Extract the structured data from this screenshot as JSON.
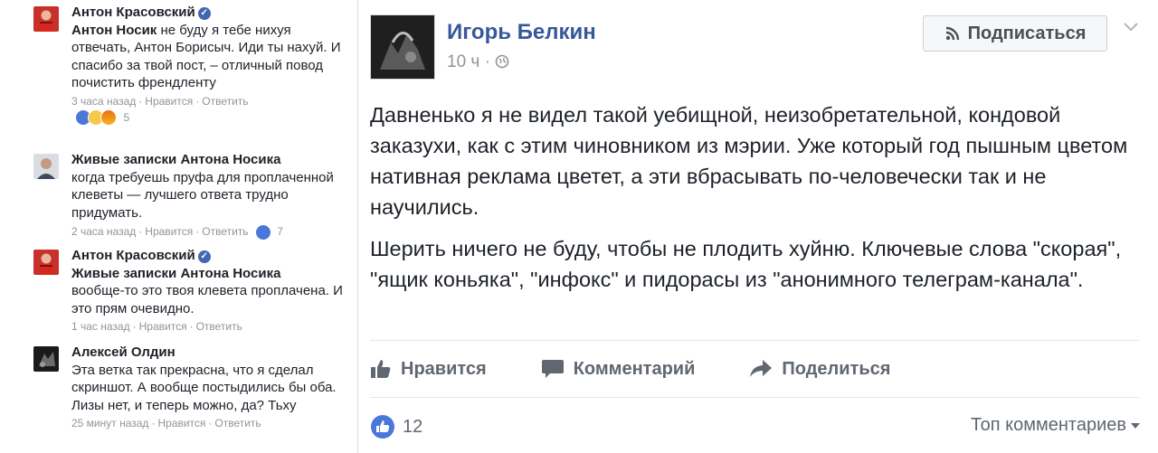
{
  "comments": [
    {
      "author": "Антон Красовский",
      "verified": true,
      "mention": "Антон Носик",
      "text": " не буду я тебе нихуя отвечать, Антон Борисыч. Иди ты нахуй. И спасибо за твой пост, – отличный повод почистить френдленту",
      "time": "3 часа назад",
      "like": "Нравится",
      "reply": "Ответить",
      "reactions_count": "5"
    },
    {
      "author": "Живые записки Антона Носика",
      "verified": false,
      "mention": "",
      "text": "когда требуешь пруфа для проплаченной клеветы — лучшего ответа трудно придумать.",
      "time": "2 часа назад",
      "like": "Нравится",
      "reply": "Ответить",
      "reactions_count": "7"
    },
    {
      "author": "Антон Красовский",
      "verified": true,
      "mention": "Живые записки Антона Носика",
      "text": "вообще-то это твоя клевета проплачена. И это прям очевидно.",
      "time": "1 час назад",
      "like": "Нравится",
      "reply": "Ответить",
      "reactions_count": ""
    },
    {
      "author": "Алексей Олдин",
      "verified": false,
      "mention": "",
      "text": "Эта ветка так прекрасна, что я сделал скриншот. А вообще постыдились бы оба. Лизы нет, и теперь можно, да? Тьху",
      "time": "25 минут назад",
      "like": "Нравится",
      "reply": "Ответить",
      "reactions_count": ""
    }
  ],
  "post": {
    "author": "Игорь Белкин",
    "time": "10 ч",
    "subscribe_label": "Подписаться",
    "paragraph1": "Давненько я не видел такой уебищной, неизобретательной, кондовой заказухи, как с этим чиновником из мэрии. Уже который год пышным цветом нативная реклама цветет, а эти вбрасывать по-человечески так и не научились.",
    "paragraph2": "Шерить ничего не буду, чтобы не плодить хуйню. Ключевые слова \"скорая\", \"ящик коньяка\", \"инфокс\" и пидорасы из \"анонимного телеграм-канала\".",
    "like_label": "Нравится",
    "comment_label": "Комментарий",
    "share_label": "Поделиться",
    "likes_count": "12",
    "top_comments_label": "Топ комментариев"
  },
  "colors": {
    "link_blue": "#365899",
    "meta_gray": "#90949c",
    "action_gray": "#606770",
    "like_blue": "#4a78d8"
  }
}
